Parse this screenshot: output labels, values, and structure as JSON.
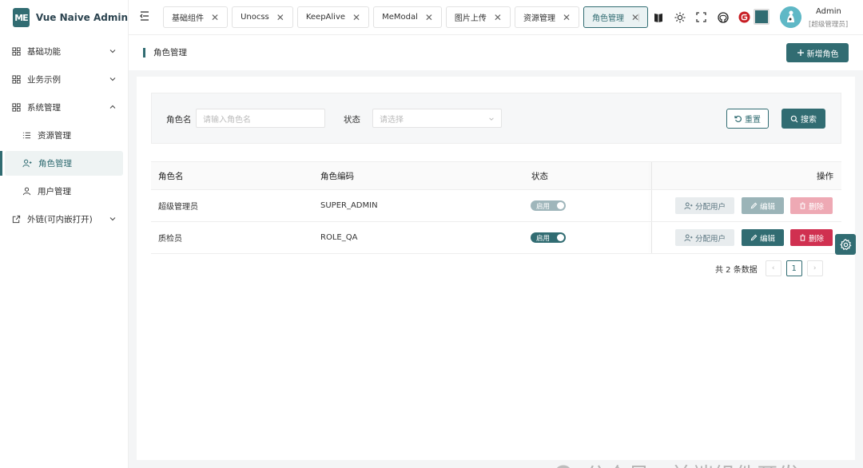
{
  "app": {
    "logo_mark": "ME",
    "title": "Vue Naive Admin"
  },
  "sidebar": {
    "items": [
      {
        "label": "基础功能",
        "icon": "grid-icon"
      },
      {
        "label": "业务示例",
        "icon": "grid-icon"
      },
      {
        "label": "系统管理",
        "icon": "grid-icon"
      },
      {
        "label": "资源管理",
        "icon": "list-icon"
      },
      {
        "label": "角色管理",
        "icon": "user-role-icon"
      },
      {
        "label": "用户管理",
        "icon": "user-icon"
      },
      {
        "label": "外链(可内嵌打开)",
        "icon": "external-link-icon"
      }
    ]
  },
  "tabs": [
    {
      "label": "基础组件"
    },
    {
      "label": "Unocss"
    },
    {
      "label": "KeepAlive"
    },
    {
      "label": "MeModal"
    },
    {
      "label": "图片上传"
    },
    {
      "label": "资源管理"
    },
    {
      "label": "角色管理",
      "active": true
    }
  ],
  "header": {
    "user_name": "Admin",
    "user_role": "[超级管理员]",
    "theme_color": "#316c72"
  },
  "page": {
    "title": "角色管理",
    "add_button": "新增角色"
  },
  "search": {
    "name_label": "角色名",
    "name_placeholder": "请输入角色名",
    "status_label": "状态",
    "status_placeholder": "请选择",
    "reset_button": "重置",
    "search_button": "搜索"
  },
  "table": {
    "headers": {
      "name": "角色名",
      "code": "角色编码",
      "status": "状态",
      "actions": "操作"
    },
    "rows": [
      {
        "name": "超级管理员",
        "code": "SUPER_ADMIN",
        "status": "启用",
        "assign": "分配用户",
        "edit": "编辑",
        "delete": "删除",
        "disabled": true
      },
      {
        "name": "质检员",
        "code": "ROLE_QA",
        "status": "启用",
        "assign": "分配用户",
        "edit": "编辑",
        "delete": "删除",
        "disabled": false
      }
    ]
  },
  "pagination": {
    "total_text": "共 2 条数据",
    "current_page": "1",
    "prev": "‹",
    "next": "›"
  },
  "watermark": {
    "text": "公众号 · 前端组件开发"
  }
}
